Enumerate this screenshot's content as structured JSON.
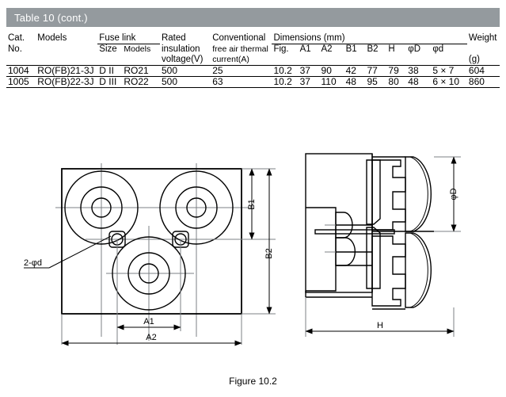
{
  "table": {
    "band_title": "Table 10 (cont.)",
    "band_color": "#949a9e",
    "headers": {
      "cat_no_l1": "Cat.",
      "cat_no_l2": "No.",
      "models": "Models",
      "fuse_link_group": "Fuse link",
      "fuse_size": "Size",
      "fuse_models": "Models",
      "rated_l1": "Rated",
      "rated_l2": "insulation",
      "rated_l3": "voltage(V)",
      "conv_l1": "Conventional",
      "conv_l2": "free air thermal",
      "conv_l3": "current(A)",
      "dimensions_group": "Dimensions  (mm)",
      "fig": "Fig.",
      "a1": "A1",
      "a2": "A2",
      "b1": "B1",
      "b2": "B2",
      "h": "H",
      "phi_d_cap": "φD",
      "phi_d_low": "φd",
      "weight_l1": "Weight",
      "weight_l2": "(g)"
    },
    "rows": [
      {
        "cat_no": "1004",
        "models": "RO(FB)21-3J",
        "fuse_size": "D II",
        "fuse_models": "RO21",
        "rated_voltage": "500",
        "conventional_current": "25",
        "fig": "10.2",
        "a1": "37",
        "a2": "90",
        "b1": "42",
        "b2": "77",
        "h": "79",
        "phi_D": "38",
        "phi_d": "5 × 7",
        "weight": "604"
      },
      {
        "cat_no": "1005",
        "models": "RO(FB)22-3J",
        "fuse_size": "D III",
        "fuse_models": "RO22",
        "rated_voltage": "500",
        "conventional_current": "63",
        "fig": "10.2",
        "a1": "37",
        "a2": "110",
        "b1": "48",
        "b2": "95",
        "h": "80",
        "phi_D": "48",
        "phi_d": "6 × 10",
        "weight": "860"
      }
    ]
  },
  "drawing": {
    "front_view": {
      "dim_a1": "A1",
      "dim_a2": "A2",
      "dim_b1": "B1",
      "dim_b2": "B2",
      "hole_callout": "2-φd"
    },
    "side_view": {
      "dim_h": "H",
      "dim_phi_d": "φD"
    }
  },
  "figure_caption": "Figure 10.2"
}
